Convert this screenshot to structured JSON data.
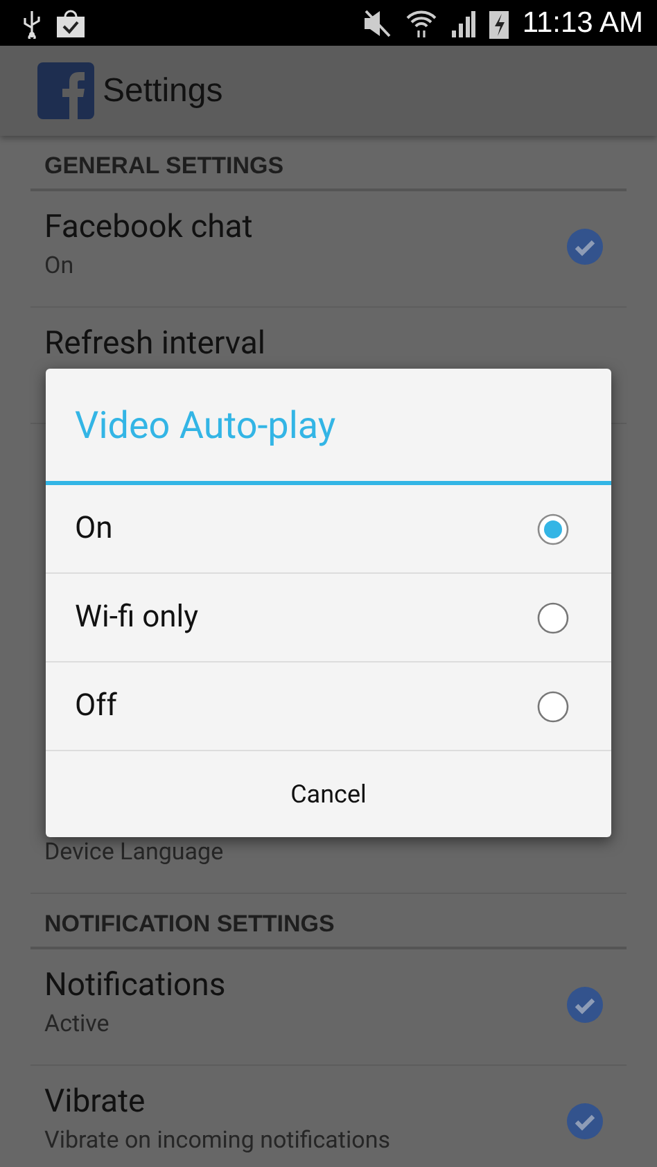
{
  "status_bar": {
    "time": "11:13 AM"
  },
  "app_bar": {
    "title": "Settings"
  },
  "sections": [
    {
      "header": "GENERAL SETTINGS",
      "items": [
        {
          "title": "Facebook chat",
          "subtitle": "On",
          "kind": "checkbox",
          "checked": true
        },
        {
          "title": "Refresh interval",
          "kind": "plain"
        },
        {
          "subtitle": "Device Language",
          "kind": "plain"
        }
      ]
    },
    {
      "header": "NOTIFICATION SETTINGS",
      "items": [
        {
          "title": "Notifications",
          "subtitle": "Active",
          "kind": "checkbox",
          "checked": true
        },
        {
          "title": "Vibrate",
          "subtitle": "Vibrate on incoming notifications",
          "kind": "checkbox",
          "checked": true
        }
      ]
    }
  ],
  "dialog": {
    "title": "Video Auto-play",
    "options": [
      {
        "label": "On",
        "selected": true
      },
      {
        "label": "Wi-fi only",
        "selected": false
      },
      {
        "label": "Off",
        "selected": false
      }
    ],
    "cancel": "Cancel"
  }
}
